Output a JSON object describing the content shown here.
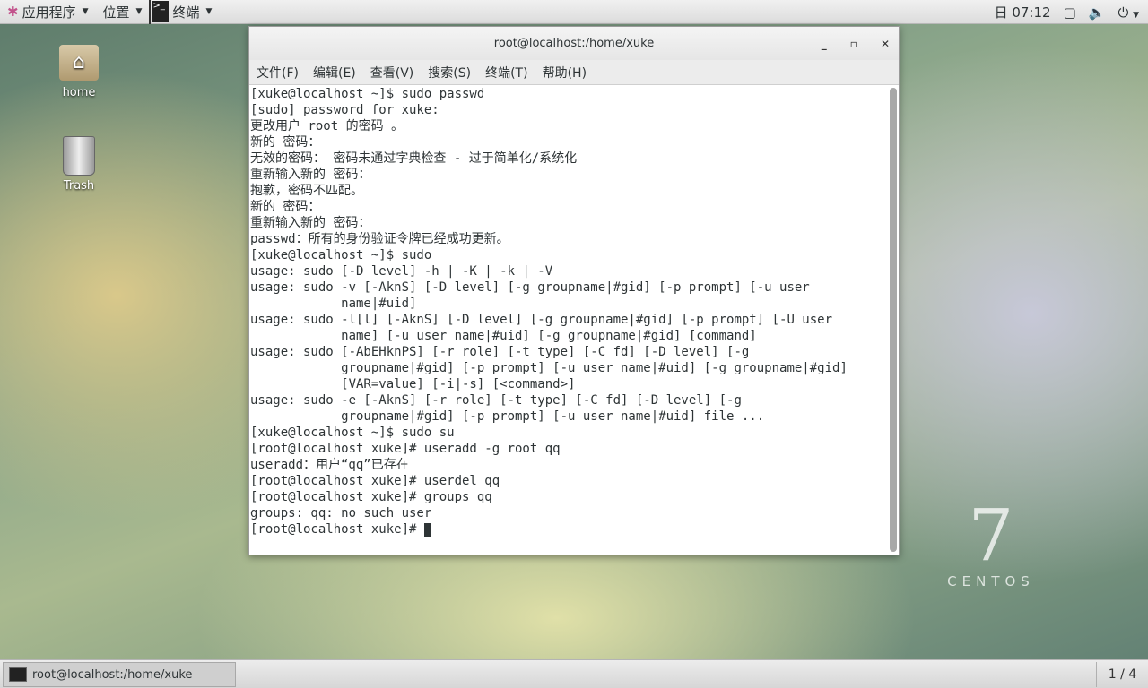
{
  "topbar": {
    "applications": "应用程序",
    "places": "位置",
    "terminal": "终端",
    "clock": "日 07:12"
  },
  "desktop": {
    "home": "home",
    "trash": "Trash"
  },
  "window": {
    "title": "root@localhost:/home/xuke",
    "menu": [
      "文件(F)",
      "编辑(E)",
      "查看(V)",
      "搜索(S)",
      "终端(T)",
      "帮助(H)"
    ]
  },
  "terminal": {
    "lines": [
      "[xuke@localhost ~]$ sudo passwd",
      "[sudo] password for xuke:",
      "更改用户 root 的密码 。",
      "新的 密码：",
      "无效的密码： 密码未通过字典检查 - 过于简单化/系统化",
      "重新输入新的 密码：",
      "抱歉，密码不匹配。",
      "新的 密码：",
      "重新输入新的 密码：",
      "passwd：所有的身份验证令牌已经成功更新。",
      "[xuke@localhost ~]$ sudo",
      "usage: sudo [-D level] -h | -K | -k | -V",
      "usage: sudo -v [-AknS] [-D level] [-g groupname|#gid] [-p prompt] [-u user",
      "            name|#uid]",
      "usage: sudo -l[l] [-AknS] [-D level] [-g groupname|#gid] [-p prompt] [-U user",
      "            name] [-u user name|#uid] [-g groupname|#gid] [command]",
      "usage: sudo [-AbEHknPS] [-r role] [-t type] [-C fd] [-D level] [-g",
      "            groupname|#gid] [-p prompt] [-u user name|#uid] [-g groupname|#gid]",
      "            [VAR=value] [-i|-s] [<command>]",
      "usage: sudo -e [-AknS] [-r role] [-t type] [-C fd] [-D level] [-g",
      "            groupname|#gid] [-p prompt] [-u user name|#uid] file ...",
      "[xuke@localhost ~]$ sudo su",
      "[root@localhost xuke]# useradd -g root qq",
      "useradd：用户“qq”已存在",
      "[root@localhost xuke]# userdel qq",
      "[root@localhost xuke]# groups qq",
      "groups: qq: no such user",
      "[root@localhost xuke]# "
    ]
  },
  "branding": {
    "number": "7",
    "word": "CENTOS"
  },
  "taskbar": {
    "task": "root@localhost:/home/xuke",
    "workspace": "1 / 4"
  }
}
